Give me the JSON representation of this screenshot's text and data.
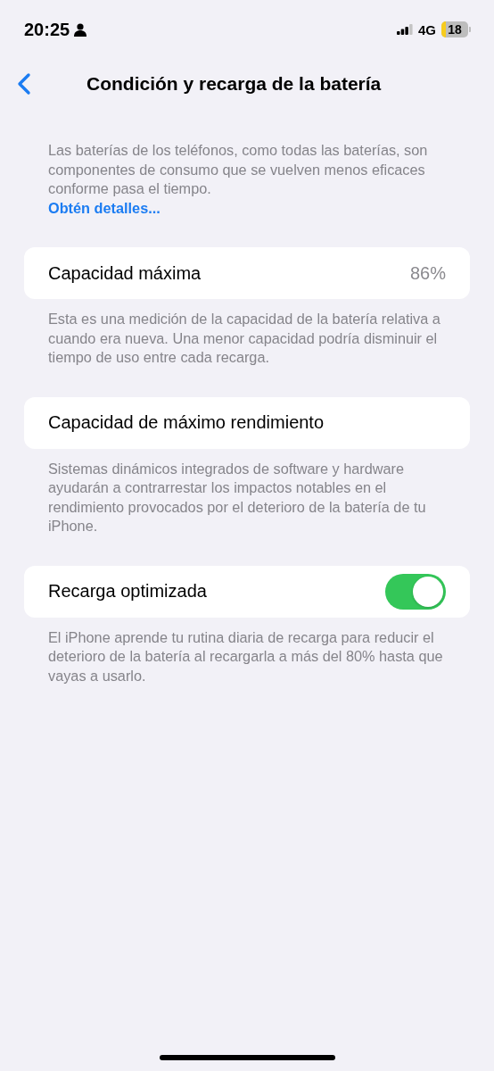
{
  "status_bar": {
    "time": "20:25",
    "network": "4G",
    "battery": "18"
  },
  "nav": {
    "title": "Condición y recarga de la batería"
  },
  "intro": {
    "text": "Las baterías de los teléfonos, como todas las baterías, son componentes de consumo que se vuelven menos eficaces conforme pasa el tiempo.",
    "link": "Obtén detalles..."
  },
  "sections": [
    {
      "kind": "value",
      "label": "Capacidad máxima",
      "value": "86%",
      "footer": "Esta es una medición de la capacidad de la batería relativa a cuando era nueva. Una menor capacidad podría disminuir el tiempo de uso entre cada recarga."
    },
    {
      "kind": "plain",
      "label": "Capacidad de máximo rendimiento",
      "footer": "Sistemas dinámicos integrados de software y hardware ayudarán a contrarrestar los impactos notables en el rendimiento provocados por el deterioro de la batería de tu iPhone."
    },
    {
      "kind": "toggle",
      "label": "Recarga optimizada",
      "on": true,
      "footer": "El iPhone aprende tu rutina diaria de recarga para reducir el deterioro de la batería al recargarla a más del 80% hasta que vayas a usarlo."
    }
  ]
}
